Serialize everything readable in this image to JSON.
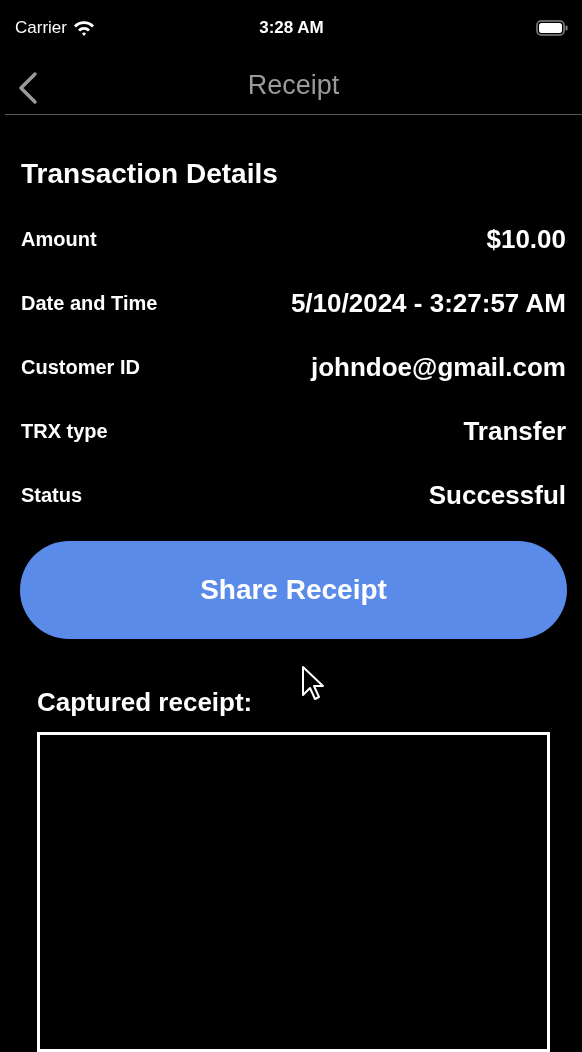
{
  "status_bar": {
    "carrier": "Carrier",
    "time": "3:28 AM"
  },
  "nav": {
    "title": "Receipt"
  },
  "section_title": "Transaction Details",
  "details": [
    {
      "label": "Amount",
      "value": "$10.00"
    },
    {
      "label": "Date and Time",
      "value": "5/10/2024 - 3:27:57 AM"
    },
    {
      "label": "Customer ID",
      "value": "johndoe@gmail.com"
    },
    {
      "label": "TRX type",
      "value": "Transfer"
    },
    {
      "label": "Status",
      "value": "Successful"
    }
  ],
  "share_button": "Share Receipt",
  "captured_title": "Captured receipt:"
}
